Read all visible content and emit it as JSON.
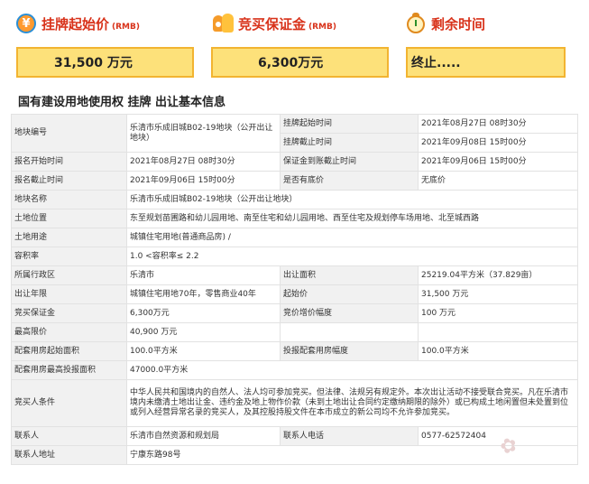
{
  "cards": [
    {
      "title": "挂牌起始价",
      "unit": "(RMB)",
      "value": "31,500 万元",
      "icon": "price-tag-icon"
    },
    {
      "title": "竞买保证金",
      "unit": "(RMB)",
      "value": "6,300万元",
      "icon": "people-icon"
    },
    {
      "title": "剩余时间",
      "unit": "",
      "value": "终止.....",
      "icon": "alarm-clock-icon"
    }
  ],
  "section_title": "国有建设用地使用权 挂牌 出让基本信息",
  "rows": {
    "parcel_no_label": "地块编号",
    "parcel_no": "乐清市乐成旧城B02-19地块（公开出让地块）",
    "listing_start_label": "挂牌起始时间",
    "listing_start": "2021年08月27日 08时30分",
    "listing_end_label": "挂牌截止时间",
    "listing_end": "2021年09月08日 15时00分",
    "signup_start_label": "报名开始时间",
    "signup_start": "2021年08月27日 08时30分",
    "deposit_deadline_label": "保证金到账截止时间",
    "deposit_deadline": "2021年09月06日 15时00分",
    "signup_end_label": "报名截止时间",
    "signup_end": "2021年09月06日 15时00分",
    "reserve_label": "是否有底价",
    "reserve": "无底价",
    "parcel_name_label": "地块名称",
    "parcel_name": "乐清市乐成旧城B02-19地块（公开出让地块）",
    "location_label": "土地位置",
    "location": "东至规划苗圃路和幼儿园用地、南至住宅和幼儿园用地、西至住宅及规划停车场用地、北至城西路",
    "use_label": "土地用途",
    "use": "城镇住宅用地(普通商品房) /",
    "far_label": "容积率",
    "far": "1.0 <容积率≤ 2.2",
    "district_label": "所属行政区",
    "district": "乐清市",
    "area_label": "出让面积",
    "area": "25219.04平方米（37.829亩）",
    "term_label": "出让年限",
    "term": "城镇住宅用地70年，零售商业40年",
    "start_price_label": "起始价",
    "start_price": "31,500 万元",
    "deposit_label": "竞买保证金",
    "deposit": "6,300万元",
    "increment_label": "竞价增价幅度",
    "increment": "100 万元",
    "max_price_label": "最高限价",
    "max_price": "40,900 万元",
    "housing_start_label": "配套用房起始面积",
    "housing_start": "100.0平方米",
    "housing_step_label": "投报配套用房幅度",
    "housing_step": "100.0平方米",
    "housing_max_label": "配套用房最高投报面积",
    "housing_max": "47000.0平方米",
    "conditions_label": "竞买人条件",
    "conditions": "中华人民共和国境内的自然人、法人均可参加竞买。但法律、法规另有规定外。本次出让活动不接受联合竞买。凡在乐清市境内未缴清土地出让金、违约金及地上物作价款（未到土地出让合同约定缴纳期限的除外）或已构成土地闲置但未处置到位或列入经营异常名录的竞买人，及其控股持股文件在本市成立的新公司均不允许参加竞买。",
    "contact_label": "联系人",
    "contact": "乐清市自然资源和规划局",
    "phone_label": "联系人电话",
    "phone": "0577-62572404",
    "address_label": "联系人地址",
    "address": "宁康东路98号"
  }
}
